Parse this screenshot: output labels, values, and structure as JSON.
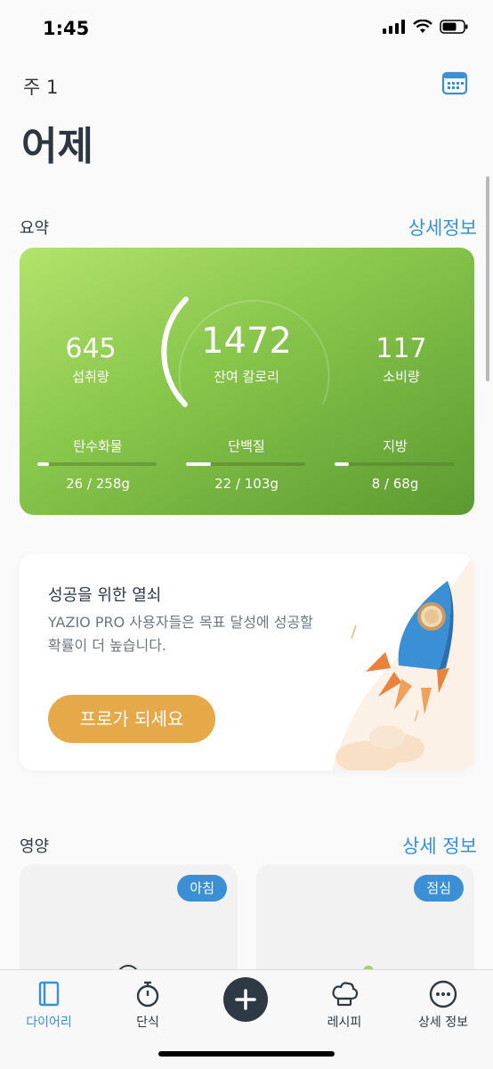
{
  "status_bar": {
    "time": "1:45"
  },
  "header": {
    "week": "주 1",
    "title": "어제"
  },
  "summary": {
    "section_title": "요약",
    "details_link": "상세정보",
    "eaten_value": "645",
    "eaten_label": "섭취량",
    "remaining_value": "1472",
    "remaining_label": "잔여 칼로리",
    "burned_value": "117",
    "burned_label": "소비량",
    "macros": [
      {
        "label": "탄수화물",
        "value": "26 / 258g",
        "progress": 0.1
      },
      {
        "label": "단백질",
        "value": "22 / 103g",
        "progress": 0.21
      },
      {
        "label": "지방",
        "value": "8 / 68g",
        "progress": 0.12
      }
    ]
  },
  "promo": {
    "title": "성공을 위한 열쇠",
    "description": "YAZIO PRO 사용자들은 목표 달성에 성공할 확률이 더 높습니다.",
    "button_label": "프로가 되세요"
  },
  "nutrition": {
    "section_title": "영양",
    "details_link": "상세 정보",
    "meals": [
      {
        "badge": "아침"
      },
      {
        "badge": "점심"
      }
    ]
  },
  "tab_bar": {
    "items": [
      {
        "label": "다이어리"
      },
      {
        "label": "단식"
      },
      {
        "label": "레시피"
      },
      {
        "label": "상세 정보"
      }
    ]
  },
  "colors": {
    "accent": "#3b8fd4",
    "promo_button": "#e5a94a",
    "card_green": "#86c44a"
  }
}
